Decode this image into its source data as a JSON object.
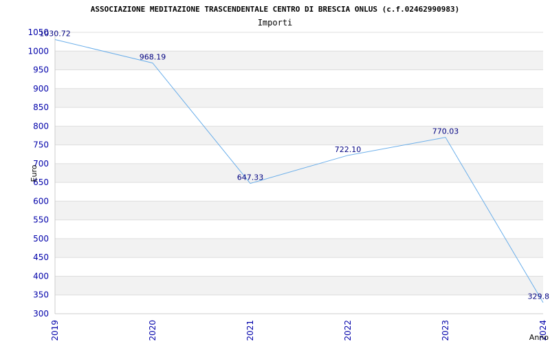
{
  "chart_data": {
    "type": "line",
    "title": "ASSOCIAZIONE MEDITAZIONE TRASCENDENTALE CENTRO DI BRESCIA ONLUS (c.f.02462990983)",
    "subtitle": "Importi",
    "xlabel": "Anno",
    "ylabel": "Euro",
    "categories": [
      "2019",
      "2020",
      "2021",
      "2022",
      "2023",
      "2024"
    ],
    "values": [
      1030.72,
      968.19,
      647.33,
      722.1,
      770.03,
      329.8
    ],
    "value_labels": [
      "1030.72",
      "968.19",
      "647.33",
      "722.10",
      "770.03",
      "329.8"
    ],
    "ylim": [
      300,
      1050
    ],
    "yticks": [
      300,
      350,
      400,
      450,
      500,
      550,
      600,
      650,
      700,
      750,
      800,
      850,
      900,
      950,
      1000,
      1050
    ],
    "grid": "horizontal",
    "colors": {
      "line": "#6aaeea",
      "band": "#f2f2f2",
      "gridline": "#dddddd",
      "tick_text": "#0000aa",
      "data_text": "#000080"
    }
  }
}
